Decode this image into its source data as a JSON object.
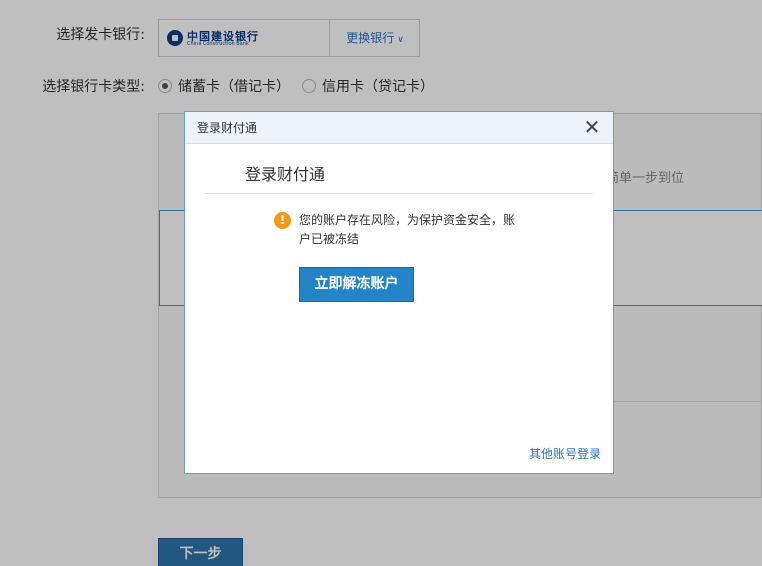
{
  "form": {
    "bank_label": "选择发卡银行:",
    "card_type_label": "选择银行卡类型:",
    "bank_logo_cn": "中国建设银行",
    "bank_logo_en": "China Construction Bank",
    "change_bank": "更换银行",
    "card_types": [
      {
        "label": "储蓄卡（借记卡）",
        "selected": true
      },
      {
        "label": "信用卡（贷记卡）",
        "selected": false
      }
    ],
    "panel_hint": "捷简单一步到位",
    "next_button": "下一步"
  },
  "dialog": {
    "title": "登录财付通",
    "heading": "登录财付通",
    "warning_icon": "!",
    "warning_text": "您的账户存在风险，为保护资金安全，账户已被冻结",
    "unfreeze_button": "立即解冻账户",
    "other_login": "其他账号登录",
    "close_symbol": "✕"
  },
  "colors": {
    "accent": "#2484c8",
    "link": "#2a74c4",
    "warning": "#f19a1a"
  }
}
